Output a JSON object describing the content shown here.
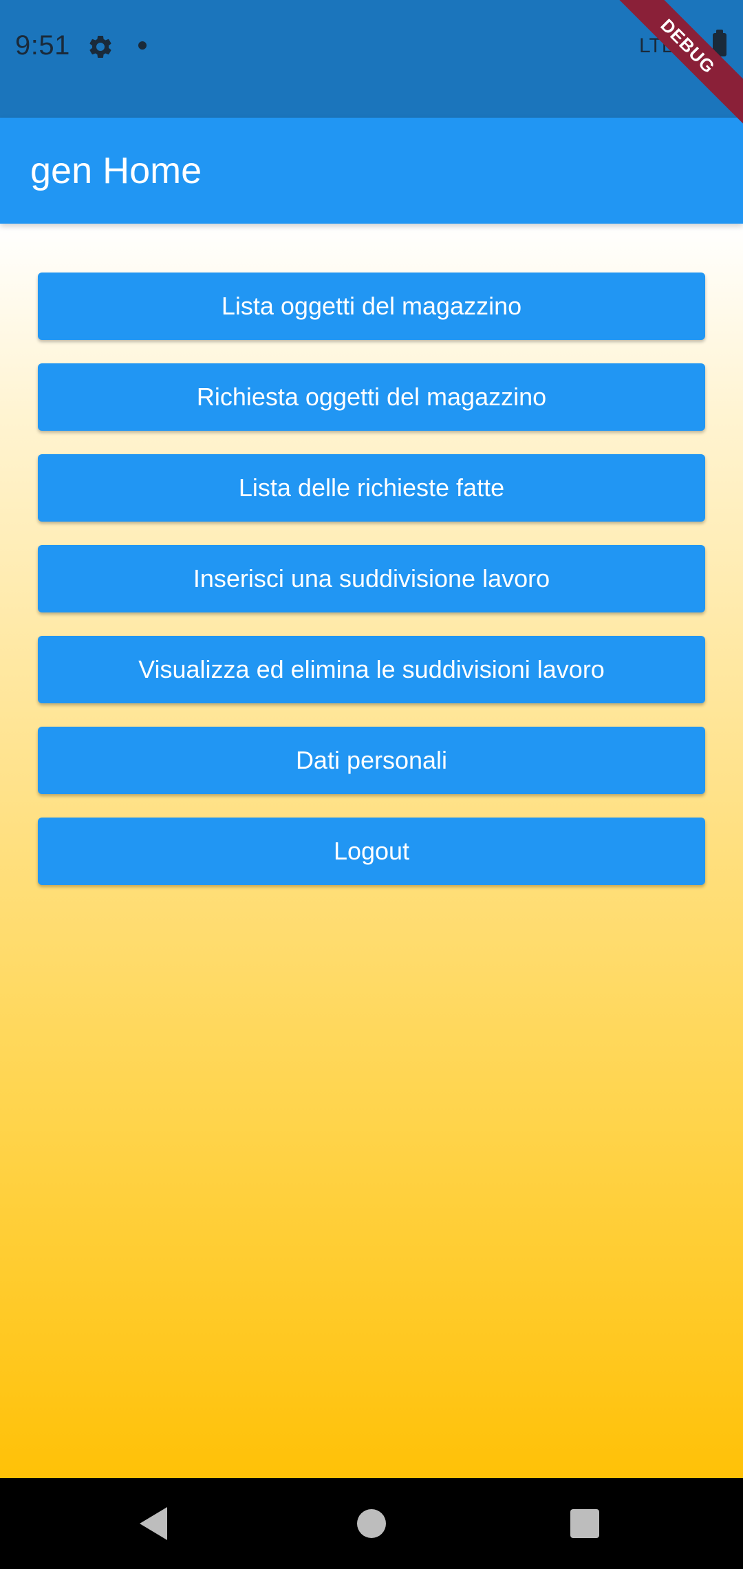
{
  "status_bar": {
    "time": "9:51",
    "network": "LTE",
    "icons": [
      "gear-icon",
      "notification-dot-icon",
      "battery-icon"
    ]
  },
  "debug_banner": "DEBUG",
  "app_bar": {
    "title": "gen Home"
  },
  "menu": {
    "buttons": [
      {
        "label": "Lista oggetti del magazzino"
      },
      {
        "label": "Richiesta oggetti del magazzino"
      },
      {
        "label": "Lista delle richieste fatte"
      },
      {
        "label": "Inserisci una suddivisione lavoro"
      },
      {
        "label": "Visualizza ed elimina le suddivisioni lavoro"
      },
      {
        "label": "Dati personali"
      },
      {
        "label": "Logout"
      }
    ]
  },
  "navigation_bar": {
    "icons": [
      "back-icon",
      "home-icon",
      "recents-icon"
    ]
  },
  "colors": {
    "status_bar": "#1b75bc",
    "app_bar": "#2196f3",
    "button": "#2196f3",
    "gradient_top": "#ffffff",
    "gradient_bottom": "#ffc107",
    "debug_banner": "#8a2038"
  }
}
